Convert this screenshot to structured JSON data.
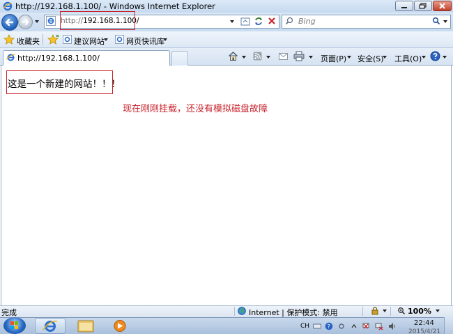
{
  "window": {
    "title": "http://192.168.1.100/ - Windows Internet Explorer"
  },
  "address_bar": {
    "scheme": "http://",
    "host_path": "192.168.1.100/"
  },
  "search": {
    "placeholder": "Bing"
  },
  "favorites_bar": {
    "favorites_label": "收藏夹",
    "items": [
      {
        "label": "建议网站"
      },
      {
        "label": "网页快讯库"
      }
    ]
  },
  "tab": {
    "label": "http://192.168.1.100/"
  },
  "command_bar": {
    "page_label": "页面(P)",
    "safety_label": "安全(S)",
    "tools_label": "工具(O)"
  },
  "page": {
    "body_text": "这是一个新建的网站！！！",
    "annotation": "现在刚刚挂载，还没有模拟磁盘故障"
  },
  "status_bar": {
    "status": "完成",
    "zone": "Internet | 保护模式: 禁用",
    "zoom": "100%"
  },
  "taskbar": {
    "language": "CH",
    "time": "22:44",
    "date": "2015/4/21"
  },
  "colors": {
    "annotation_red": "#c8232c",
    "titlebar": "#dce9f7"
  }
}
